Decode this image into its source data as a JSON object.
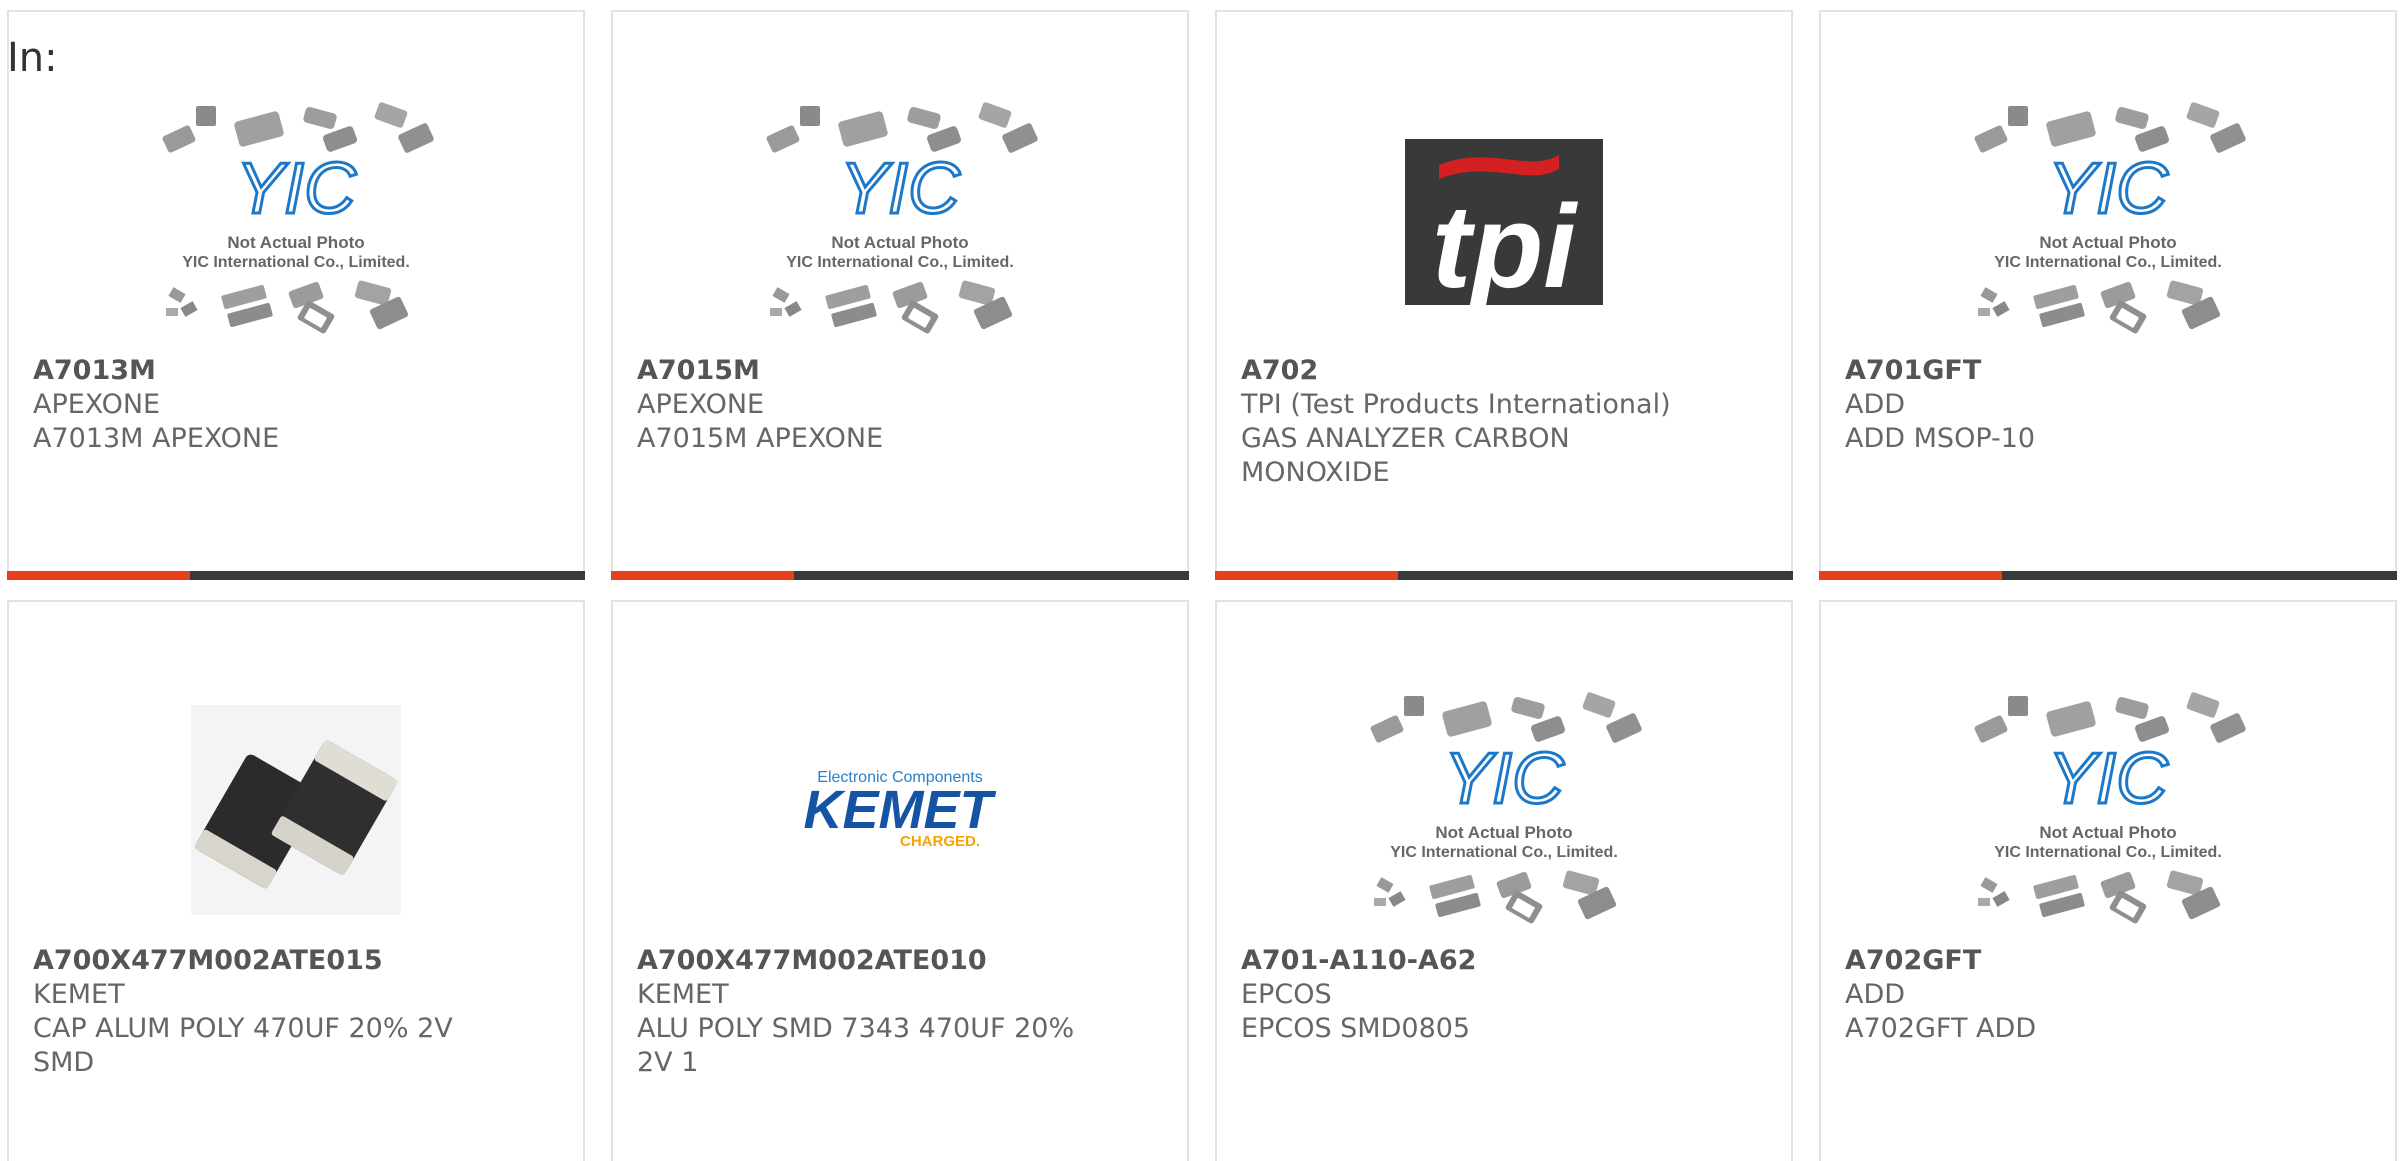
{
  "header": {
    "in_label": "In:"
  },
  "placeholder": {
    "line1": "Not Actual Photo",
    "line2": "YIC International Co., Limited.",
    "logo": "YIC"
  },
  "logos": {
    "tpi": "tpi",
    "kemet_top": "Electronic Components",
    "kemet_main": "KEMET",
    "kemet_sub": "CHARGED."
  },
  "products": [
    {
      "part": "A7013M",
      "maker": "APEXONE",
      "desc": "A7013M APEXONE",
      "image": "placeholder"
    },
    {
      "part": "A7015M",
      "maker": "APEXONE",
      "desc": "A7015M APEXONE",
      "image": "placeholder"
    },
    {
      "part": "A702",
      "maker": "TPI (Test Products International)",
      "desc": "GAS ANALYZER CARBON MONOXIDE",
      "image": "tpi-logo"
    },
    {
      "part": "A701GFT",
      "maker": "ADD",
      "desc": "ADD MSOP-10",
      "image": "placeholder"
    },
    {
      "part": "A700X477M002ATE015",
      "maker": "KEMET",
      "desc": "CAP ALUM POLY 470UF 20% 2V SMD",
      "image": "smd-capacitor-photo"
    },
    {
      "part": "A700X477M002ATE010",
      "maker": "KEMET",
      "desc": "ALU POLY SMD 7343 470UF 20% 2V 1",
      "image": "kemet-logo"
    },
    {
      "part": "A701-A110-A62",
      "maker": "EPCOS",
      "desc": "EPCOS SMD0805",
      "image": "placeholder"
    },
    {
      "part": "A702GFT",
      "maker": "ADD",
      "desc": "A702GFT ADD",
      "image": "placeholder"
    }
  ],
  "colors": {
    "accent": "#e8401c",
    "bar_dark": "#3a3a3a",
    "yic_blue": "#1e78c8",
    "tpi_red": "#d42020",
    "kemet_blue": "#1553a5",
    "kemet_orange": "#f5a300"
  }
}
